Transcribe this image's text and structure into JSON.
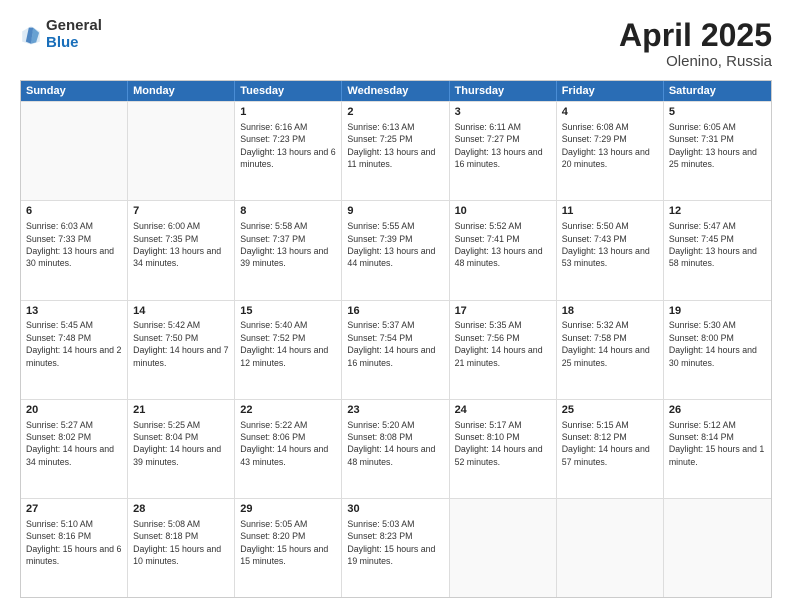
{
  "logo": {
    "general": "General",
    "blue": "Blue"
  },
  "title": {
    "month": "April 2025",
    "location": "Olenino, Russia"
  },
  "calendar": {
    "days": [
      "Sunday",
      "Monday",
      "Tuesday",
      "Wednesday",
      "Thursday",
      "Friday",
      "Saturday"
    ],
    "rows": [
      [
        {
          "day": "",
          "text": ""
        },
        {
          "day": "",
          "text": ""
        },
        {
          "day": "1",
          "text": "Sunrise: 6:16 AM\nSunset: 7:23 PM\nDaylight: 13 hours and 6 minutes."
        },
        {
          "day": "2",
          "text": "Sunrise: 6:13 AM\nSunset: 7:25 PM\nDaylight: 13 hours and 11 minutes."
        },
        {
          "day": "3",
          "text": "Sunrise: 6:11 AM\nSunset: 7:27 PM\nDaylight: 13 hours and 16 minutes."
        },
        {
          "day": "4",
          "text": "Sunrise: 6:08 AM\nSunset: 7:29 PM\nDaylight: 13 hours and 20 minutes."
        },
        {
          "day": "5",
          "text": "Sunrise: 6:05 AM\nSunset: 7:31 PM\nDaylight: 13 hours and 25 minutes."
        }
      ],
      [
        {
          "day": "6",
          "text": "Sunrise: 6:03 AM\nSunset: 7:33 PM\nDaylight: 13 hours and 30 minutes."
        },
        {
          "day": "7",
          "text": "Sunrise: 6:00 AM\nSunset: 7:35 PM\nDaylight: 13 hours and 34 minutes."
        },
        {
          "day": "8",
          "text": "Sunrise: 5:58 AM\nSunset: 7:37 PM\nDaylight: 13 hours and 39 minutes."
        },
        {
          "day": "9",
          "text": "Sunrise: 5:55 AM\nSunset: 7:39 PM\nDaylight: 13 hours and 44 minutes."
        },
        {
          "day": "10",
          "text": "Sunrise: 5:52 AM\nSunset: 7:41 PM\nDaylight: 13 hours and 48 minutes."
        },
        {
          "day": "11",
          "text": "Sunrise: 5:50 AM\nSunset: 7:43 PM\nDaylight: 13 hours and 53 minutes."
        },
        {
          "day": "12",
          "text": "Sunrise: 5:47 AM\nSunset: 7:45 PM\nDaylight: 13 hours and 58 minutes."
        }
      ],
      [
        {
          "day": "13",
          "text": "Sunrise: 5:45 AM\nSunset: 7:48 PM\nDaylight: 14 hours and 2 minutes."
        },
        {
          "day": "14",
          "text": "Sunrise: 5:42 AM\nSunset: 7:50 PM\nDaylight: 14 hours and 7 minutes."
        },
        {
          "day": "15",
          "text": "Sunrise: 5:40 AM\nSunset: 7:52 PM\nDaylight: 14 hours and 12 minutes."
        },
        {
          "day": "16",
          "text": "Sunrise: 5:37 AM\nSunset: 7:54 PM\nDaylight: 14 hours and 16 minutes."
        },
        {
          "day": "17",
          "text": "Sunrise: 5:35 AM\nSunset: 7:56 PM\nDaylight: 14 hours and 21 minutes."
        },
        {
          "day": "18",
          "text": "Sunrise: 5:32 AM\nSunset: 7:58 PM\nDaylight: 14 hours and 25 minutes."
        },
        {
          "day": "19",
          "text": "Sunrise: 5:30 AM\nSunset: 8:00 PM\nDaylight: 14 hours and 30 minutes."
        }
      ],
      [
        {
          "day": "20",
          "text": "Sunrise: 5:27 AM\nSunset: 8:02 PM\nDaylight: 14 hours and 34 minutes."
        },
        {
          "day": "21",
          "text": "Sunrise: 5:25 AM\nSunset: 8:04 PM\nDaylight: 14 hours and 39 minutes."
        },
        {
          "day": "22",
          "text": "Sunrise: 5:22 AM\nSunset: 8:06 PM\nDaylight: 14 hours and 43 minutes."
        },
        {
          "day": "23",
          "text": "Sunrise: 5:20 AM\nSunset: 8:08 PM\nDaylight: 14 hours and 48 minutes."
        },
        {
          "day": "24",
          "text": "Sunrise: 5:17 AM\nSunset: 8:10 PM\nDaylight: 14 hours and 52 minutes."
        },
        {
          "day": "25",
          "text": "Sunrise: 5:15 AM\nSunset: 8:12 PM\nDaylight: 14 hours and 57 minutes."
        },
        {
          "day": "26",
          "text": "Sunrise: 5:12 AM\nSunset: 8:14 PM\nDaylight: 15 hours and 1 minute."
        }
      ],
      [
        {
          "day": "27",
          "text": "Sunrise: 5:10 AM\nSunset: 8:16 PM\nDaylight: 15 hours and 6 minutes."
        },
        {
          "day": "28",
          "text": "Sunrise: 5:08 AM\nSunset: 8:18 PM\nDaylight: 15 hours and 10 minutes."
        },
        {
          "day": "29",
          "text": "Sunrise: 5:05 AM\nSunset: 8:20 PM\nDaylight: 15 hours and 15 minutes."
        },
        {
          "day": "30",
          "text": "Sunrise: 5:03 AM\nSunset: 8:23 PM\nDaylight: 15 hours and 19 minutes."
        },
        {
          "day": "",
          "text": ""
        },
        {
          "day": "",
          "text": ""
        },
        {
          "day": "",
          "text": ""
        }
      ]
    ]
  }
}
